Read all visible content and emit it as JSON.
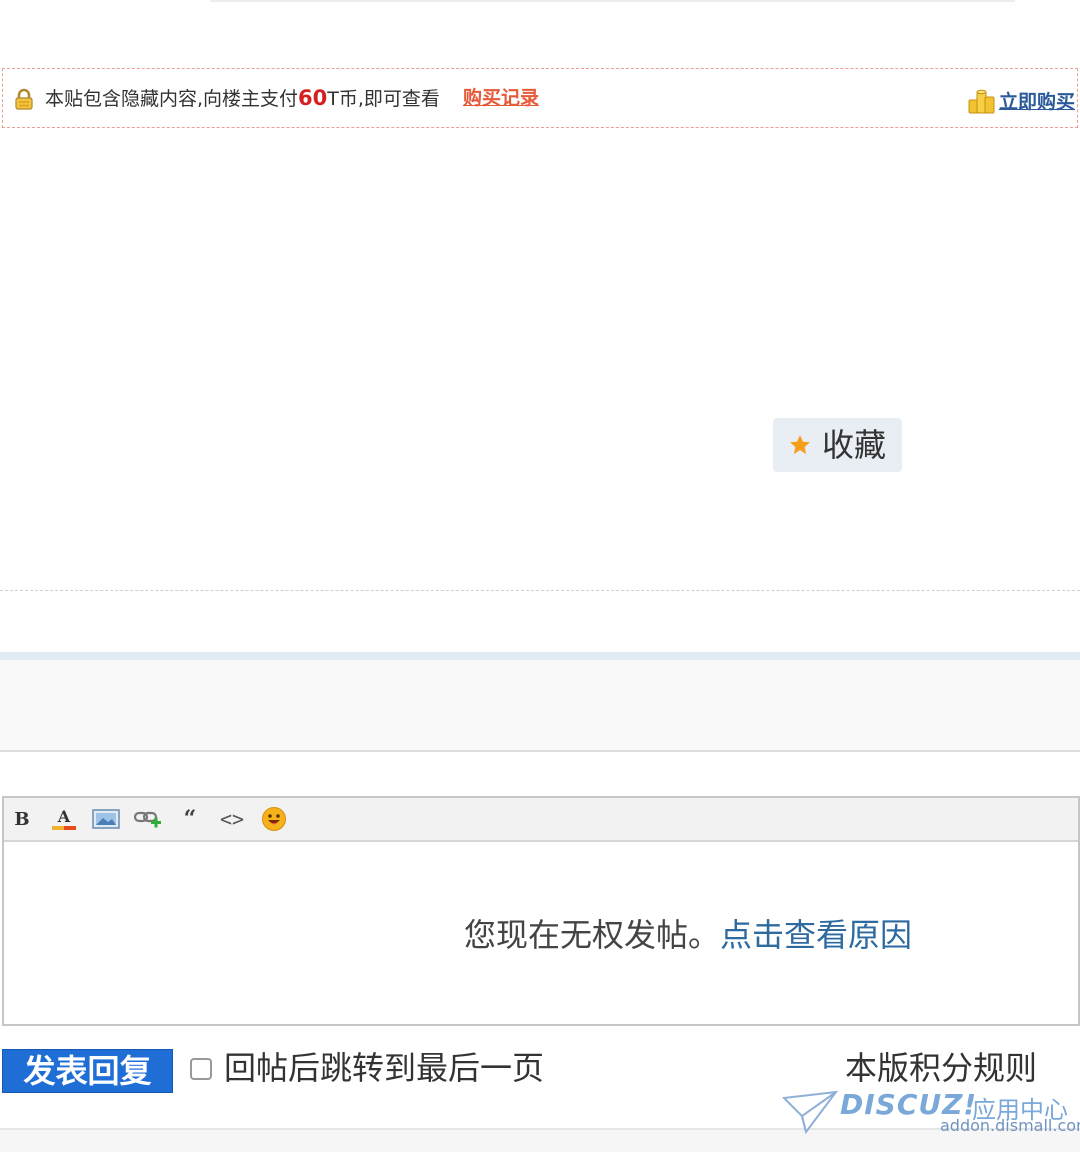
{
  "notice": {
    "text_before": "本贴包含隐藏内容,向楼主支付",
    "price": "60",
    "text_after": "T币,即可查看",
    "buy_record_label": "购买记录",
    "buy_now_label": "立即购买",
    "lock_icon": "lock-icon",
    "coins_icon": "coins-icon"
  },
  "favorite": {
    "label": "收藏",
    "icon": "star-icon"
  },
  "editor": {
    "toolbar_icons": [
      "bold-icon",
      "font-color-icon",
      "image-icon",
      "link-icon",
      "quote-icon",
      "code-icon",
      "emoji-icon"
    ],
    "bold_glyph": "B",
    "font_color_glyph": "A",
    "quote_glyph": "“",
    "code_glyph": "<>",
    "no_permission_text": "您现在无权发帖。",
    "why_link_label": "点击查看原因"
  },
  "reply": {
    "submit_label": "发表回复",
    "jump_checkbox_label": "回帖后跳转到最后一页",
    "jump_checked": false,
    "rules_link_label": "本版积分规则"
  },
  "watermark": {
    "brand": "DISCUZ!",
    "cn": "应用中心",
    "url": "addon.dismall.com"
  },
  "colors": {
    "accent_blue": "#1f6ed6",
    "link_blue": "#2c6aa0",
    "price_red": "#d42020",
    "record_orange": "#e65a3a"
  }
}
